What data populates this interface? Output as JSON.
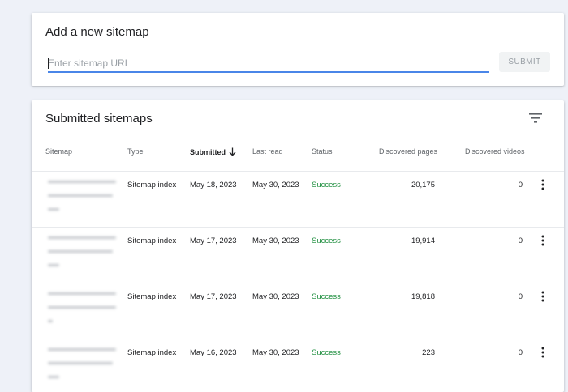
{
  "add_sitemap": {
    "title": "Add a new sitemap",
    "url_placeholder": "Enter sitemap URL",
    "url_value": "",
    "submit_label": "SUBMIT"
  },
  "submitted": {
    "title": "Submitted sitemaps",
    "filter_icon": "filter-icon",
    "columns": {
      "sitemap": "Sitemap",
      "type": "Type",
      "submitted": "Submitted",
      "last_read": "Last read",
      "status": "Status",
      "discovered_pages": "Discovered pages",
      "discovered_videos": "Discovered videos"
    },
    "sort": {
      "column": "submitted",
      "direction": "descending"
    },
    "rows": [
      {
        "type": "Sitemap index",
        "submitted": "May 18, 2023",
        "last_read": "May 30, 2023",
        "status": "Success",
        "pages": "20,175",
        "videos": "0"
      },
      {
        "type": "Sitemap index",
        "submitted": "May 17, 2023",
        "last_read": "May 30, 2023",
        "status": "Success",
        "pages": "19,914",
        "videos": "0"
      },
      {
        "type": "Sitemap index",
        "submitted": "May 17, 2023",
        "last_read": "May 30, 2023",
        "status": "Success",
        "pages": "19,818",
        "videos": "0"
      },
      {
        "type": "Sitemap index",
        "submitted": "May 16, 2023",
        "last_read": "May 30, 2023",
        "status": "Success",
        "pages": "223",
        "videos": "0"
      }
    ]
  },
  "colors": {
    "background": "#eef1f8",
    "accent_blue": "#4a86e8",
    "status_success": "#1e8e3e",
    "muted_text": "#5f6368"
  }
}
